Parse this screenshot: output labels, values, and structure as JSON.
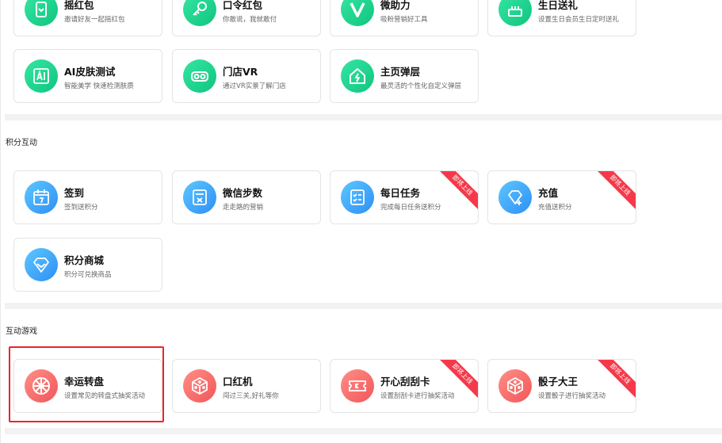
{
  "sections": [
    {
      "title": ""
    },
    {
      "title": "积分互动"
    },
    {
      "title": "互动游戏"
    }
  ],
  "ribbon_label": "即将上线",
  "cards": [
    {
      "title": "摇红包",
      "desc": "邀请好友一起摇红包",
      "icon": "shake-phone-icon",
      "color": "#10c47e"
    },
    {
      "title": "口令红包",
      "desc": "你敢说，我就敢付",
      "icon": "key-icon",
      "color": "#10c47e"
    },
    {
      "title": "微助力",
      "desc": "吸粉营销好工具",
      "icon": "v-letter-icon",
      "color": "#10c47e"
    },
    {
      "title": "生日送礼",
      "desc": "设置生日会员生日定时送礼",
      "icon": "cake-icon",
      "color": "#10c47e"
    },
    {
      "title": "AI皮肤测试",
      "desc": "智能美学 快速检测肤质",
      "icon": "ai-icon",
      "color": "#10c47e"
    },
    {
      "title": "门店VR",
      "desc": "通过VR实景了解门店",
      "icon": "vr-glasses-icon",
      "color": "#10c47e"
    },
    {
      "title": "主页弹层",
      "desc": "最灵活的个性化自定义弹层",
      "icon": "home-popup-icon",
      "color": "#10c47e"
    },
    {
      "title": "签到",
      "desc": "签到送积分",
      "icon": "calendar-icon",
      "color": "#2f8ff5"
    },
    {
      "title": "微信步数",
      "desc": "走走路的营销",
      "icon": "calculator-icon",
      "color": "#2f8ff5"
    },
    {
      "title": "每日任务",
      "desc": "完成每日任务送积分",
      "icon": "task-list-icon",
      "color": "#2f8ff5",
      "coming": true
    },
    {
      "title": "充值",
      "desc": "充值送积分",
      "icon": "diamond-plus-icon",
      "color": "#2f8ff5",
      "coming": true
    },
    {
      "title": "积分商城",
      "desc": "积分可兑换商品",
      "icon": "diamond-icon",
      "color": "#2f8ff5"
    },
    {
      "title": "幸运转盘",
      "desc": "设置常见的转盘式抽奖活动",
      "icon": "wheel-icon",
      "color": "#f2565a"
    },
    {
      "title": "口红机",
      "desc": "闯过三关,好礼等你",
      "icon": "dice-icon",
      "color": "#f2565a"
    },
    {
      "title": "开心刮刮卡",
      "desc": "设置刮刮卡进行抽奖活动",
      "icon": "scratch-card-icon",
      "color": "#f2565a",
      "coming": true
    },
    {
      "title": "骰子大王",
      "desc": "设置骰子进行抽奖活动",
      "icon": "dice-icon",
      "color": "#f2565a",
      "coming": true
    }
  ]
}
